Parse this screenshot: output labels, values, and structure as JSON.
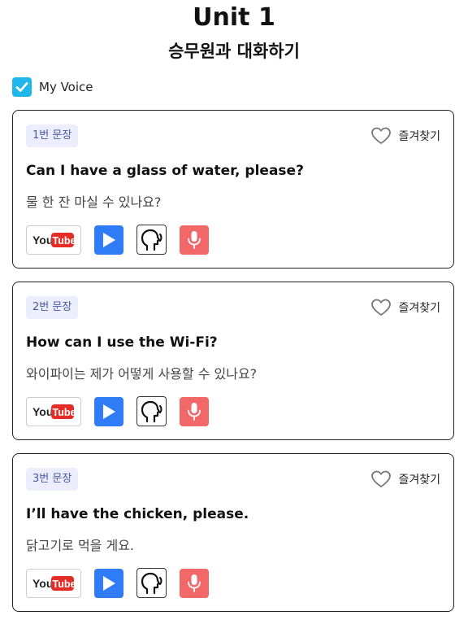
{
  "header": {
    "title": "Unit 1",
    "subtitle": "승무원과 대화하기"
  },
  "voice_toggle": {
    "label": "My Voice",
    "checked": true
  },
  "favorite_label": "즐겨찾기",
  "youtube_label": {
    "you": "You",
    "tube": "Tube"
  },
  "colors": {
    "checkbox": "#1fb6ec",
    "play_button": "#2f7cf6",
    "mic_button": "#f26868",
    "youtube_red": "#e52d27",
    "badge_bg": "#eceefe",
    "badge_text": "#4957a3"
  },
  "icons": [
    "check-icon",
    "heart-icon",
    "youtube-logo",
    "play-icon",
    "speaking-head-icon",
    "mic-icon"
  ],
  "cards": [
    {
      "badge": "1번 문장",
      "english": "Can I have a glass of water, please?",
      "korean": "물 한 잔 마실 수 있나요?"
    },
    {
      "badge": "2번 문장",
      "english": "How can I use the Wi-Fi?",
      "korean": "와이파이는 제가 어떻게 사용할 수 있나요?"
    },
    {
      "badge": "3번 문장",
      "english": "I’ll have the chicken, please.",
      "korean": "닭고기로 먹을 게요."
    }
  ]
}
